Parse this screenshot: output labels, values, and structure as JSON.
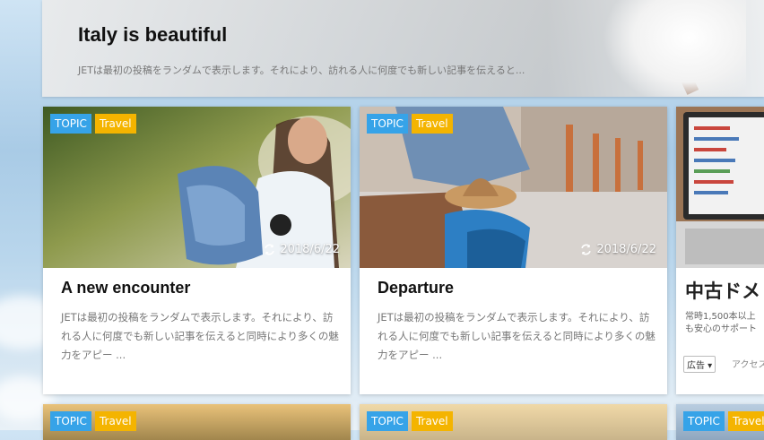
{
  "hero": {
    "title": "Italy is beautiful",
    "excerpt": "JETは最初の投稿をランダムで表示します。それにより、訪れる人に何度でも新しい記事を伝えると..."
  },
  "cards": [
    {
      "badges": [
        "TOPIC",
        "Travel"
      ],
      "date": "2018/6/22",
      "title": "A new encounter",
      "excerpt": "JETは最初の投稿をランダムで表示します。それにより、訪れる人に何度でも新しい記事を伝えると同時により多くの魅力をアピー ..."
    },
    {
      "badges": [
        "TOPIC",
        "Travel"
      ],
      "date": "2018/6/22",
      "title": "Departure",
      "excerpt": "JETは最初の投稿をランダムで表示します。それにより、訪れる人に何度でも新しい記事を伝えると同時により多くの魅力をアピー ..."
    },
    {
      "title": "中古ドメ",
      "excerpt_line1": "常時1,500本以上",
      "excerpt_line2": "も安心のサポート",
      "ad_select": "広告 ▾",
      "ad_access": "アクセス"
    }
  ],
  "row2": [
    {
      "badges": [
        "TOPIC",
        "Travel"
      ]
    },
    {
      "badges": [
        "TOPIC",
        "Travel"
      ]
    },
    {
      "badges": [
        "TOPIC",
        "Travel"
      ]
    }
  ],
  "colors": {
    "topic": "#36a3e8",
    "travel": "#f4b400"
  },
  "icons": {
    "date": "refresh-icon"
  }
}
